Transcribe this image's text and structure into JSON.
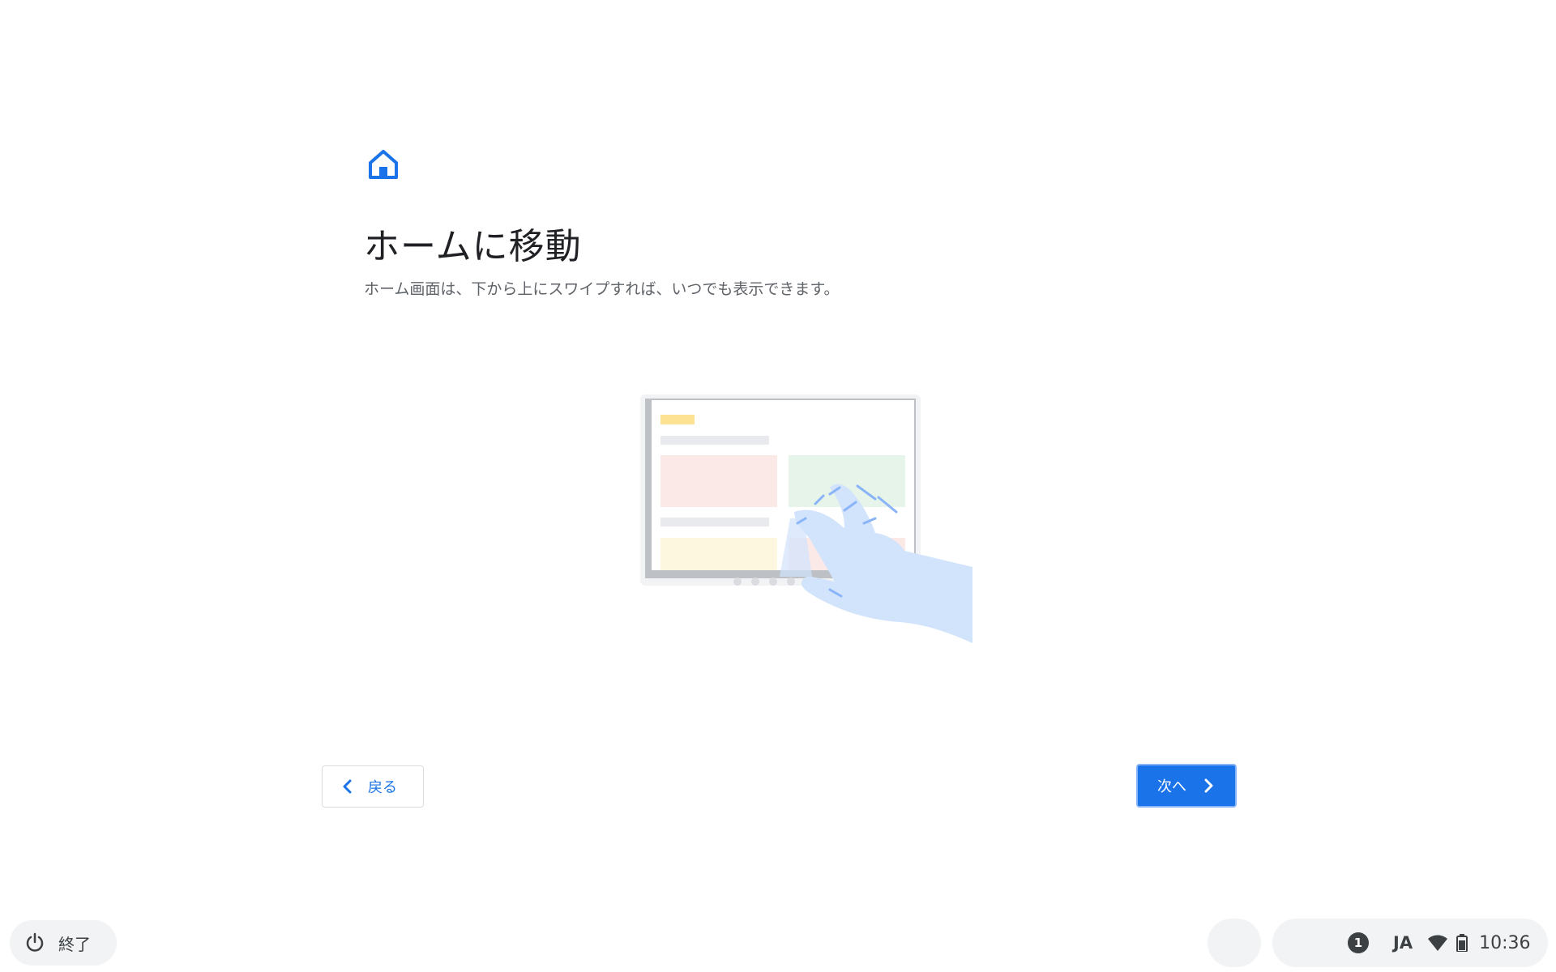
{
  "page": {
    "title": "ホームに移動",
    "subtitle": "ホーム画面は、下から上にスワイプすれば、いつでも表示できます。",
    "header_icon": "home-icon",
    "illustration_icon": "tablet-swipe-up-illustration"
  },
  "navigation": {
    "back_label": "戻る",
    "next_label": "次へ"
  },
  "shelf": {
    "shutdown_label": "終了",
    "notification_count": "1",
    "ime_label": "JA",
    "clock": "10:36",
    "icons": [
      "power-icon",
      "wifi-icon",
      "battery-icon"
    ]
  },
  "colors": {
    "accent": "#1a73e8",
    "title": "#202124",
    "subtitle": "#5f6368",
    "shelf_bg": "#f1f3f4"
  }
}
